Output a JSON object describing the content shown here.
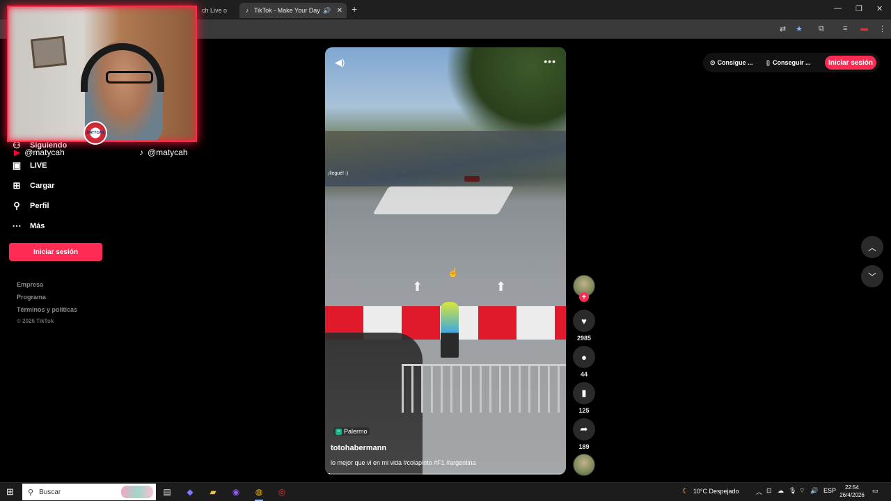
{
  "browser": {
    "tabs": [
      {
        "label": "ch Live o",
        "active": false
      },
      {
        "label": "TikTok - Make Your Day",
        "active": true
      }
    ]
  },
  "sidebar": {
    "items": [
      {
        "label": "Siguiendo",
        "icon": "following-icon"
      },
      {
        "label": "LIVE",
        "icon": "live-icon"
      },
      {
        "label": "Cargar",
        "icon": "upload-icon"
      },
      {
        "label": "Perfil",
        "icon": "profile-icon"
      },
      {
        "label": "Más",
        "icon": "more-icon"
      }
    ],
    "login_label": "Iniciar sesión",
    "footer_links": [
      "Empresa",
      "Programa",
      "Términos y políticas"
    ],
    "copyright": "© 2026 TikTok"
  },
  "overlay": {
    "youtube_handle": "@matycah",
    "tiktok_handle": "@matycah",
    "badge_text": "MATYCAH"
  },
  "video": {
    "overlay_text": "¡llegué! :)",
    "location": "Palermo",
    "author": "totohabermann",
    "caption": "lo mejor que vi en mi vida #colapinto #F1 #argentina",
    "progress": 0.02
  },
  "actions": {
    "likes": "2985",
    "comments": "44",
    "saves": "125",
    "shares": "189"
  },
  "header": {
    "coins_label": "Consigue ...",
    "app_label": "Conseguir ...",
    "login_label": "Iniciar sesión"
  },
  "taskbar": {
    "search_placeholder": "Buscar",
    "weather": "10°C  Despejado",
    "language": "ESP",
    "time": "22:54",
    "date": "26/4/2026"
  },
  "colors": {
    "accent": "#fe2c55",
    "webcam_border": "#ff2a4a"
  }
}
